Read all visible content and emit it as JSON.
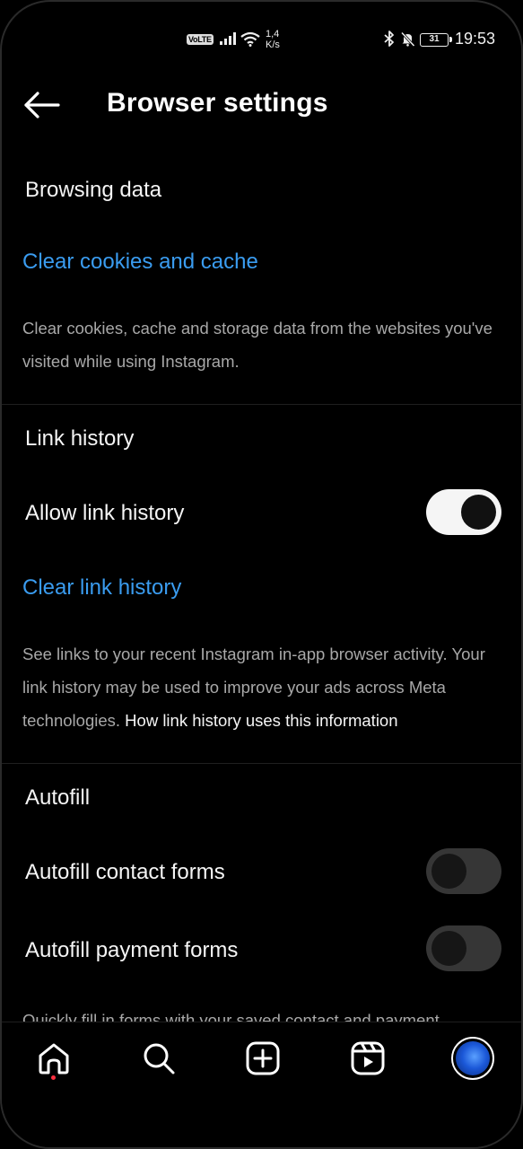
{
  "status_bar": {
    "network_badge": "VoLTE",
    "speed_value": "1,4",
    "speed_unit": "K/s",
    "battery": "31",
    "time": "19:53"
  },
  "header": {
    "title": "Browser settings"
  },
  "browsing_data": {
    "heading": "Browsing data",
    "clear_link": "Clear cookies and cache",
    "description": "Clear cookies, cache and storage data from the websites you've visited while using Instagram."
  },
  "link_history": {
    "heading": "Link history",
    "allow_label": "Allow link history",
    "allow_enabled": true,
    "clear_link": "Clear link history",
    "description": "See links to your recent Instagram in-app browser activity. Your link history may be used to improve your ads across Meta technologies.",
    "info_link": "How link history uses this information"
  },
  "autofill": {
    "heading": "Autofill",
    "contact_label": "Autofill contact forms",
    "contact_enabled": false,
    "payment_label": "Autofill payment forms",
    "payment_enabled": false,
    "description_partial": "Quickly fill in forms with your saved contact and payment"
  },
  "bottom_nav": {
    "items": [
      "home-icon",
      "search-icon",
      "create-icon",
      "reels-icon",
      "profile-avatar"
    ],
    "active": "home-icon"
  },
  "colors": {
    "background": "#000000",
    "link": "#3a9cf0",
    "text_primary": "#f5f5f5",
    "text_secondary": "#a8a8a8",
    "notification_dot": "#ff3040"
  }
}
